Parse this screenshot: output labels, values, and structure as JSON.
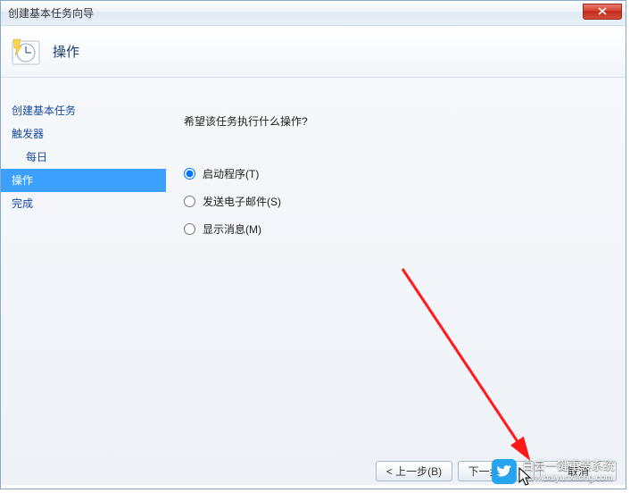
{
  "window": {
    "title": "创建基本任务向导"
  },
  "header": {
    "heading": "操作"
  },
  "sidebar": {
    "items": [
      {
        "label": "创建基本任务"
      },
      {
        "label": "触发器"
      },
      {
        "label": "每日"
      },
      {
        "label": "操作"
      },
      {
        "label": "完成"
      }
    ]
  },
  "main": {
    "question": "希望该任务执行什么操作?",
    "options": [
      {
        "label": "启动程序(T)",
        "value": "start",
        "checked": true
      },
      {
        "label": "发送电子邮件(S)",
        "value": "email",
        "checked": false
      },
      {
        "label": "显示消息(M)",
        "value": "message",
        "checked": false
      }
    ]
  },
  "buttons": {
    "back": "< 上一步(B)",
    "next": "下一步(N) >",
    "cancel": "取消"
  },
  "watermark": {
    "main": "白云一键重装系统",
    "sub": "www.baiyunxitong.com"
  }
}
